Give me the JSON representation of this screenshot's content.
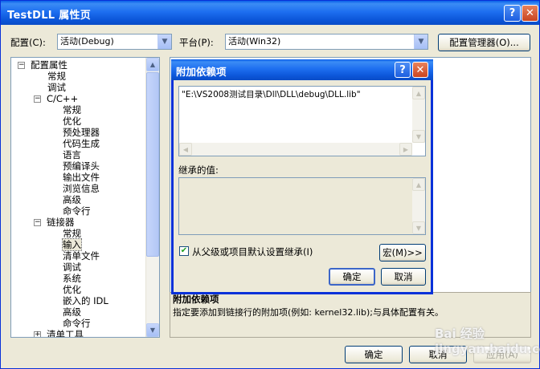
{
  "window": {
    "title": "TestDLL 属性页",
    "help_glyph": "?",
    "close_glyph": "✕"
  },
  "toolbar": {
    "config_label": "配置(C):",
    "config_value": "活动(Debug)",
    "platform_label": "平台(P):",
    "platform_value": "活动(Win32)",
    "config_manager_button": "配置管理器(O)..."
  },
  "tree": {
    "items": [
      {
        "label": "配置属性",
        "toggle": "−"
      },
      {
        "label": "常规"
      },
      {
        "label": "调试"
      },
      {
        "label": "C/C++",
        "toggle": "−"
      },
      {
        "label": "常规"
      },
      {
        "label": "优化"
      },
      {
        "label": "预处理器"
      },
      {
        "label": "代码生成"
      },
      {
        "label": "语言"
      },
      {
        "label": "预编译头"
      },
      {
        "label": "输出文件"
      },
      {
        "label": "浏览信息"
      },
      {
        "label": "高级"
      },
      {
        "label": "命令行"
      },
      {
        "label": "链接器",
        "toggle": "−"
      },
      {
        "label": "常规"
      },
      {
        "label": "输入",
        "selected": true
      },
      {
        "label": "清单文件"
      },
      {
        "label": "调试"
      },
      {
        "label": "系统"
      },
      {
        "label": "优化"
      },
      {
        "label": "嵌入的 IDL"
      },
      {
        "label": "高级"
      },
      {
        "label": "命令行"
      },
      {
        "label": "清单工具",
        "toggle": "+"
      }
    ]
  },
  "description": {
    "title": "附加依赖项",
    "text": "指定要添加到链接行的附加项(例如: kernel32.lib);与具体配置有关。"
  },
  "dialog": {
    "title": "附加依赖项",
    "help_glyph": "?",
    "close_glyph": "✕",
    "value_text": "\"E:\\VS2008测试目录\\Dll\\DLL\\debug\\DLL.lib\"",
    "inherited_label": "继承的值:",
    "inherit_checkbox_label": "从父级或项目默认设置继承(I)",
    "inherit_checked": true,
    "macro_button": "宏(M)>>",
    "ok_button": "确定",
    "cancel_button": "取消"
  },
  "footer": {
    "ok_button": "确定",
    "cancel_button": "取消",
    "apply_button": "应用(A)"
  },
  "watermark": "Bai 经验 jingyan.baidu.com"
}
